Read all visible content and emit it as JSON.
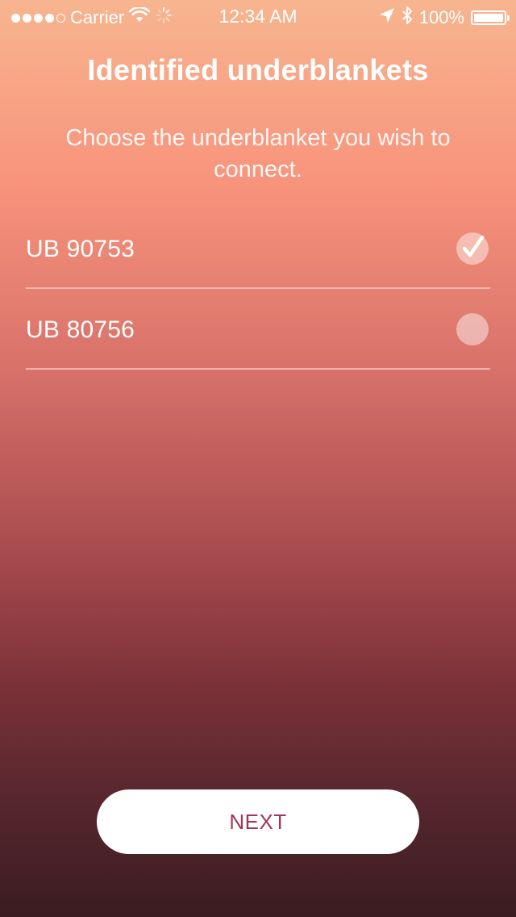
{
  "status_bar": {
    "carrier": "Carrier",
    "time": "12:34 AM",
    "battery_percent": "100%",
    "signal_bars_filled": 4,
    "signal_bars_total": 5,
    "icons": [
      "wifi-icon",
      "activity-spinner-icon",
      "location-arrow-icon",
      "bluetooth-icon",
      "battery-icon"
    ]
  },
  "header": {
    "title": "Identified underblankets",
    "subtitle": "Choose the underblanket you wish to connect."
  },
  "devices": [
    {
      "name": "UB 90753",
      "selected": true
    },
    {
      "name": "UB 80756",
      "selected": false
    }
  ],
  "actions": {
    "next_label": "NEXT"
  },
  "colors": {
    "gradient_top": "#f7b58f",
    "gradient_bottom": "#3a1c21",
    "button_text": "#a33653",
    "button_background": "#ffffff"
  }
}
